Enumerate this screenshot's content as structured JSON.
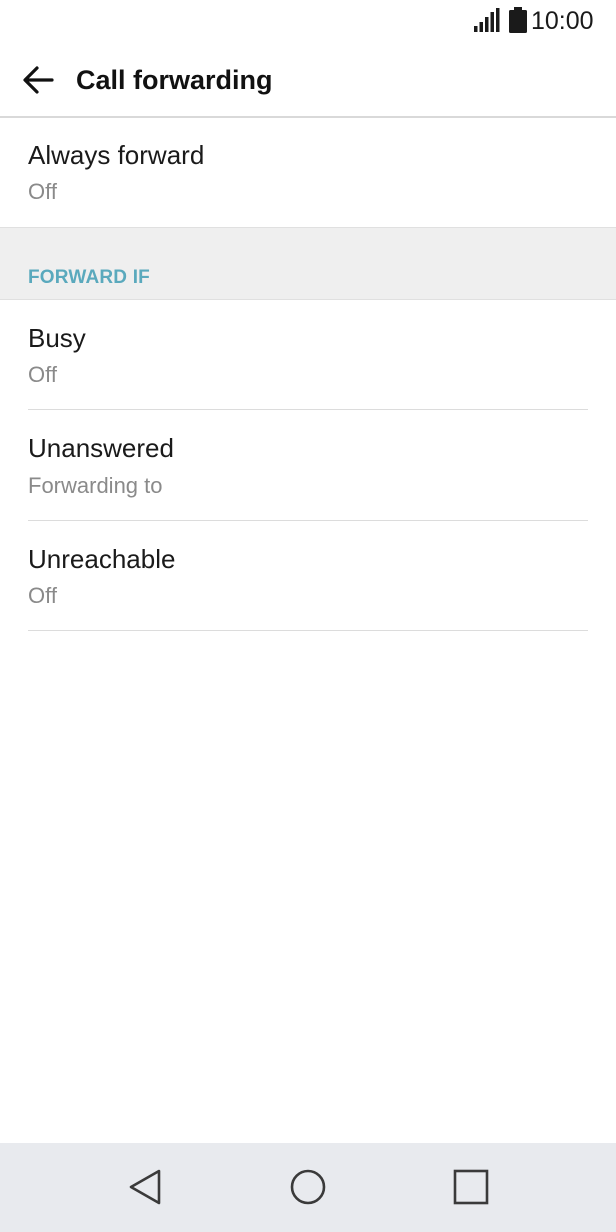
{
  "status_bar": {
    "time": "10:00",
    "signal_icon": "signal-icon",
    "battery_icon": "battery-icon"
  },
  "app_bar": {
    "back_icon": "arrow-back-icon",
    "title": "Call forwarding"
  },
  "always_forward": {
    "title": "Always forward",
    "value": "Off"
  },
  "section": {
    "header": "FORWARD IF"
  },
  "conditions": [
    {
      "title": "Busy",
      "value": "Off"
    },
    {
      "title": "Unanswered",
      "value": "Forwarding to"
    },
    {
      "title": "Unreachable",
      "value": "Off"
    }
  ],
  "nav_bar": {
    "back_icon": "nav-back-icon",
    "home_icon": "nav-home-icon",
    "recents_icon": "nav-recents-icon"
  },
  "colors": {
    "section_header": "#5aa9bd",
    "subtitle": "#8a8a8a",
    "nav_background": "#e8eaee"
  }
}
